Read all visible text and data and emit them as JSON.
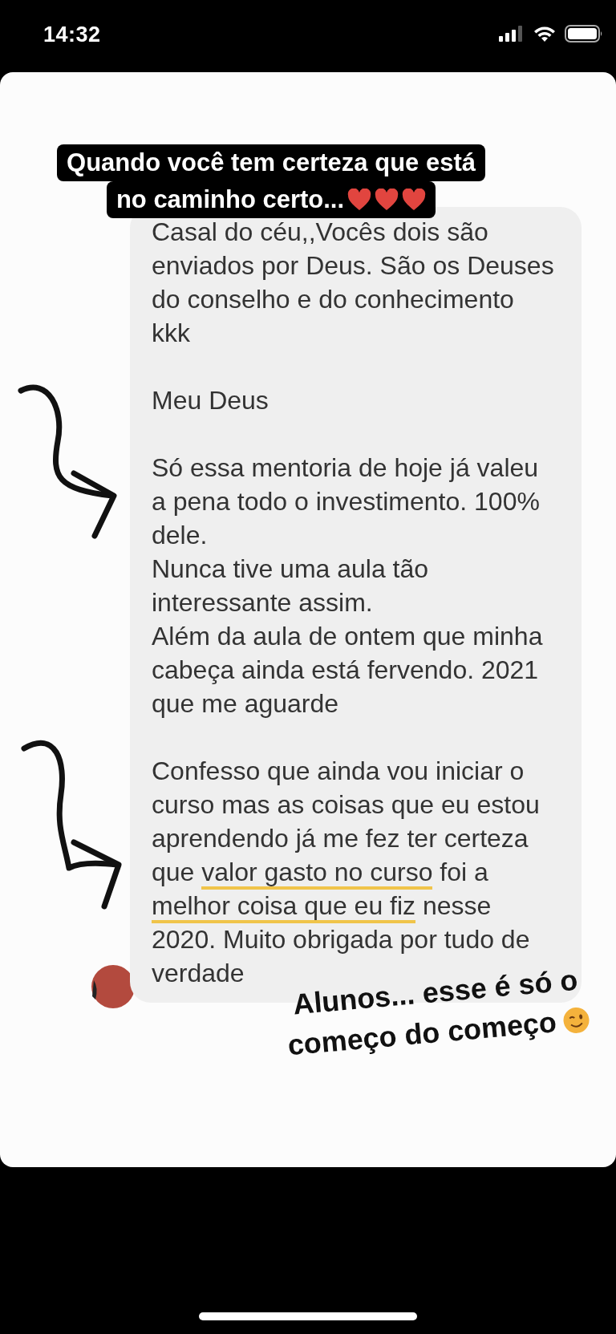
{
  "status_bar": {
    "time": "14:32"
  },
  "story": {
    "top_caption": [
      "Quando você tem certeza que está",
      "no caminho certo..."
    ],
    "message": {
      "paragraphs": [
        {
          "lines": [
            "Casal do céu,,Vocês dois são",
            "enviados por Deus. São os Deuses",
            "do conselho e do conhecimento",
            "kkk"
          ]
        },
        {
          "lines": [
            "Meu Deus"
          ]
        },
        {
          "lines": [
            "Só essa mentoria de hoje já valeu",
            "a pena todo o investimento. 100%",
            "dele.",
            "Nunca tive uma aula tão",
            "interessante assim.",
            "Além da aula de ontem que minha",
            "cabeça ainda está fervendo. 2021",
            "que me aguarde"
          ]
        },
        {
          "lines": [
            "Confesso que ainda vou iniciar o",
            "curso mas as coisas que eu estou",
            "aprendendo já me fez ter certeza",
            [
              {
                "text": "que ",
                "underlined": false
              },
              {
                "text": "valor gasto no curso",
                "underlined": true
              },
              {
                "text": " foi a",
                "underlined": false
              }
            ],
            [
              {
                "text": "melhor coisa que eu fiz",
                "underlined": true
              },
              {
                "text": " nesse",
                "underlined": false
              }
            ],
            "2020. Muito obrigada por tudo de",
            "verdade"
          ]
        }
      ]
    },
    "bottom_caption": [
      "Alunos... esse é só o",
      "começo do começo"
    ]
  }
}
